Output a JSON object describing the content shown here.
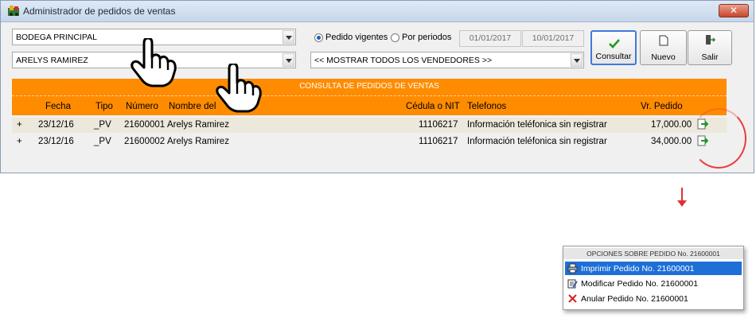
{
  "window": {
    "title": "Administrador de pedidos de ventas",
    "close": "✕"
  },
  "filters": {
    "warehouse": "BODEGA PRINCIPAL",
    "client": "ARELYS RAMIREZ",
    "vendor": "<< MOSTRAR TODOS LOS VENDEDORES >>",
    "radio_vigentes": "Pedido vigentes",
    "radio_periodos": "Por periodos",
    "date_from": "01/01/2017",
    "date_to": "10/01/2017"
  },
  "buttons": {
    "consultar": "Consultar",
    "nuevo": "Nuevo",
    "salir": "Salir"
  },
  "grid": {
    "caption": "CONSULTA DE PEDIDOS DE VENTAS",
    "headers": {
      "fecha": "Fecha",
      "tipo": "Tipo",
      "numero": "Número",
      "nombre": "Nombre del",
      "cedula": "Cédula o NIT",
      "telefonos": "Telefonos",
      "vr": "Vr. Pedido"
    },
    "rows": [
      {
        "plus": "+",
        "fecha": "23/12/16",
        "tipo": "_PV",
        "numero": "21600001",
        "nombre": "Arelys Ramirez",
        "cedula": "11106217",
        "telefonos": "Información teléfonica sin registrar",
        "vr": "17,000.00"
      },
      {
        "plus": "+",
        "fecha": "23/12/16",
        "tipo": "_PV",
        "numero": "21600002",
        "nombre": "Arelys Ramirez",
        "cedula": "11106217",
        "telefonos": "Información teléfonica sin registrar",
        "vr": "34,000.00"
      }
    ]
  },
  "menu": {
    "caption": "OPCIONES SOBRE PEDIDO No. 21600001",
    "items": [
      {
        "label": "Imprimir Pedido No. 21600001",
        "icon": "printer-icon"
      },
      {
        "label": "Modificar Pedido No. 21600001",
        "icon": "edit-icon"
      },
      {
        "label": "Anular Pedido No. 21600001",
        "icon": "cancel-x-icon"
      }
    ]
  }
}
